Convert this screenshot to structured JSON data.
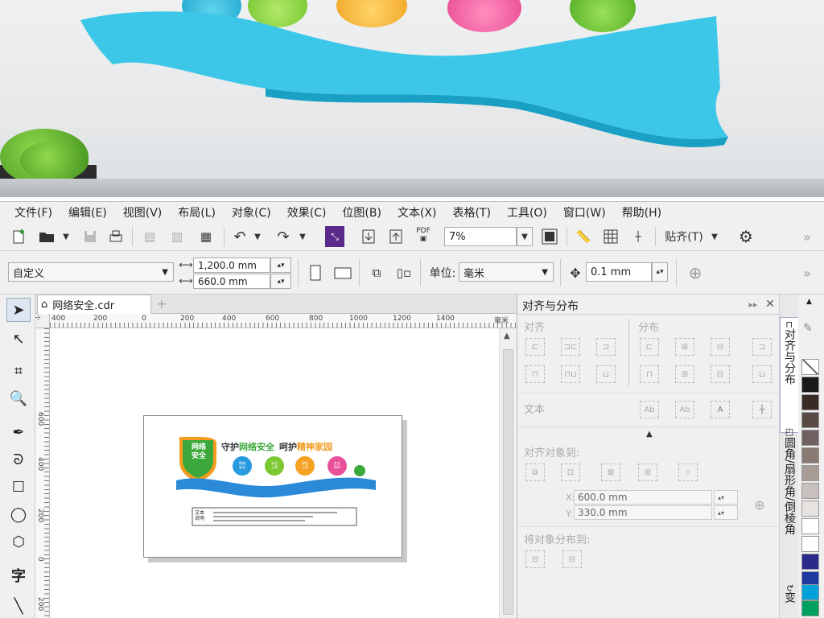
{
  "menu": [
    "文件(F)",
    "编辑(E)",
    "视图(V)",
    "布局(L)",
    "对象(C)",
    "效果(C)",
    "位图(B)",
    "文本(X)",
    "表格(T)",
    "工具(O)",
    "窗口(W)",
    "帮助(H)"
  ],
  "toolbar": {
    "zoom_value": "7%",
    "snap_label": "贴齐(T)",
    "pdf_label": "PDF"
  },
  "propbar": {
    "page_size": "自定义",
    "width": "1,200.0 mm",
    "height": "660.0 mm",
    "unit_label": "单位:",
    "unit_value": "毫米",
    "nudge": "0.1 mm"
  },
  "document": {
    "tab_name": "网络安全.cdr",
    "ruler_unit": "毫米",
    "h_ticks": [
      "400",
      "200",
      "0",
      "200",
      "400",
      "600",
      "800",
      "1000",
      "1200",
      "1400"
    ],
    "v_ticks": [
      "600",
      "400",
      "200",
      "0",
      "200"
    ],
    "design": {
      "badge_line1": "网络",
      "badge_line2": "安全",
      "slogan_a": "守护",
      "slogan_b": "网络安全",
      "slogan_c": "呵护",
      "slogan_d": "精神家园",
      "info_label": "文本\n说明",
      "circle_labels": [
        "网络\n安全",
        "安全\n上网",
        "绿色\n上网",
        "安全\n防护"
      ]
    }
  },
  "docker": {
    "title": "对齐与分布",
    "align_label": "对齐",
    "distribute_label": "分布",
    "text_label": "文本",
    "align_objects_to": "对齐对象到:",
    "x_label": "X:",
    "x_value": "600.0 mm",
    "y_label": "Y:",
    "y_value": "330.0 mm",
    "distribute_to": "将对象分布到:"
  },
  "vtabs": [
    "对齐与分布",
    "圆角/扇形角/倒棱角",
    "变"
  ],
  "palette": [
    "#ffffff",
    "#1a1a1a",
    "#3a2a26",
    "#5a4a44",
    "#706060",
    "#8a7a74",
    "#a89c96",
    "#c8c0bc",
    "#e6e2e0",
    "#ffffff",
    "#2a2a8a",
    "#1e3aa0",
    "#00a0d8",
    "#00a060"
  ]
}
